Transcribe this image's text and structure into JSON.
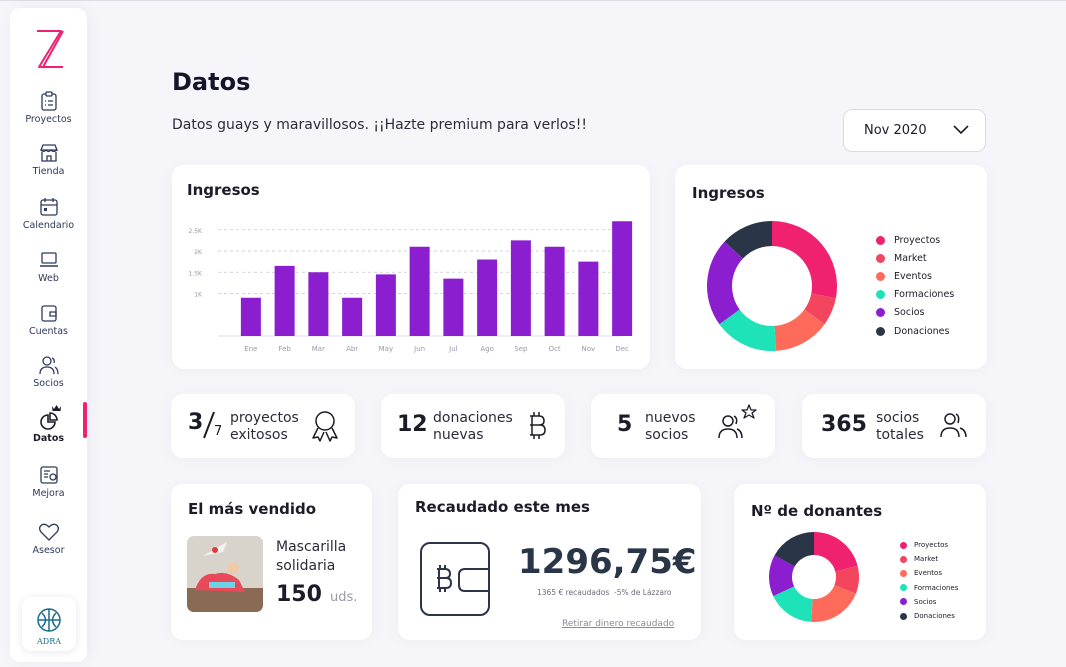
{
  "sidebar": {
    "items": [
      {
        "label": "Proyectos",
        "icon": "clipboard-icon"
      },
      {
        "label": "Tienda",
        "icon": "store-icon"
      },
      {
        "label": "Calendario",
        "icon": "calendar-icon"
      },
      {
        "label": "Web",
        "icon": "laptop-icon"
      },
      {
        "label": "Cuentas",
        "icon": "wallet-icon"
      },
      {
        "label": "Socios",
        "icon": "users-icon"
      },
      {
        "label": "Datos",
        "icon": "pie-chart-icon",
        "active": true
      },
      {
        "label": "Mejora",
        "icon": "upgrade-icon"
      },
      {
        "label": "Asesor",
        "icon": "heart-icon"
      }
    ],
    "org_logo_text": "ADRA"
  },
  "header": {
    "title": "Datos",
    "subtitle": "Datos guays y maravillosos. ¡¡Hazte premium para verlos!!",
    "month": "Nov 2020"
  },
  "colors": {
    "accent": "#f0216f",
    "bar": "#8b1fd0",
    "proyectos": "#f0216f",
    "market": "#f4455e",
    "eventos": "#ff6b5b",
    "formaciones": "#1ee3b9",
    "socios": "#8b1fd0",
    "donaciones": "#2b3548"
  },
  "chart_data": [
    {
      "type": "bar",
      "title": "Ingresos",
      "categories": [
        "Ene",
        "Feb",
        "Mar",
        "Abr",
        "May",
        "Jun",
        "Jul",
        "Ago",
        "Sep",
        "Oct",
        "Nov",
        "Dec"
      ],
      "values": [
        900,
        1650,
        1500,
        900,
        1450,
        2100,
        1350,
        1800,
        2250,
        2100,
        1750,
        2700
      ],
      "ylim": [
        0,
        2800
      ],
      "yticks": [
        {
          "value": 1000,
          "label": "1K"
        },
        {
          "value": 1500,
          "label": "1.5K"
        },
        {
          "value": 2000,
          "label": "2K"
        },
        {
          "value": 2500,
          "label": "2.5K"
        }
      ],
      "grid": true
    },
    {
      "type": "pie",
      "title": "Ingresos",
      "legend_position": "right",
      "slices": [
        {
          "label": "Proyectos",
          "value": 28
        },
        {
          "label": "Market",
          "value": 7
        },
        {
          "label": "Eventos",
          "value": 14
        },
        {
          "label": "Formaciones",
          "value": 16
        },
        {
          "label": "Socios",
          "value": 22
        },
        {
          "label": "Donaciones",
          "value": 13
        }
      ]
    },
    {
      "type": "pie",
      "title": "Nº de donantes",
      "legend_position": "right",
      "slices": [
        {
          "label": "Proyectos",
          "value": 21
        },
        {
          "label": "Market",
          "value": 10
        },
        {
          "label": "Eventos",
          "value": 20
        },
        {
          "label": "Formaciones",
          "value": 17
        },
        {
          "label": "Socios",
          "value": 15
        },
        {
          "label": "Donaciones",
          "value": 17
        }
      ]
    }
  ],
  "stats": {
    "projects": {
      "num": "3",
      "den": "7",
      "label1": "proyectos",
      "label2": "exitosos"
    },
    "donations": {
      "num": "12",
      "label1": "donaciones",
      "label2": "nuevas"
    },
    "new_members": {
      "num": "5",
      "label1": "nuevos",
      "label2": "socios"
    },
    "total_members": {
      "num": "365",
      "label1": "socios",
      "label2": "totales"
    }
  },
  "best_seller": {
    "title": "El más vendido",
    "product_line1": "Mascarilla",
    "product_line2": "solidaria",
    "qty": "150",
    "unit": "uds."
  },
  "raised": {
    "title": "Recaudado este mes",
    "amount": "1296,75€",
    "detail": "1365 € recaudados  -5% de Lázzaro",
    "link": "Retirar dinero recaudado"
  }
}
